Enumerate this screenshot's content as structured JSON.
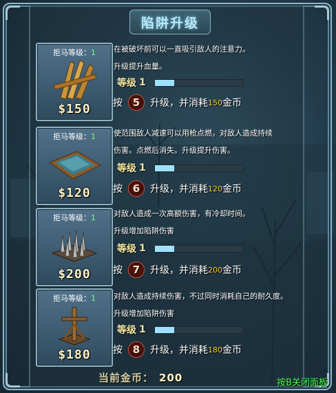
{
  "panel": {
    "title": "陷阱升级",
    "current_gold_label": "当前金币：",
    "current_gold_value": "200",
    "close_hint": "按B关闭面板"
  },
  "traps": [
    {
      "card_label": "拒马等级：",
      "card_level": "1",
      "price": "$150",
      "icon": "spiked-stakes-icon",
      "desc_line1": "在被破坏前可以一直吸引敌人的注意力。",
      "desc_line2": "升级提升血量。",
      "level_label": "等级",
      "level_value": "1",
      "level_progress_percent": 22,
      "press_label": "按",
      "key": "5",
      "upgrade_text": "升级，并消耗",
      "cost": "150",
      "currency": "金币"
    },
    {
      "card_label": "拒马等级：",
      "card_level": "1",
      "price": "$120",
      "icon": "oil-slick-trap-icon",
      "desc_line1": "使范围敌人减速可以用枪点燃，对敌人造成持续",
      "desc_line2": "伤害。点燃后消失。升级提升伤害。",
      "level_label": "等级",
      "level_value": "1",
      "level_progress_percent": 22,
      "press_label": "按",
      "key": "6",
      "upgrade_text": "升级，并消耗",
      "cost": "120",
      "currency": "金币"
    },
    {
      "card_label": "拒马等级：",
      "card_level": "1",
      "price": "$200",
      "icon": "spike-trap-icon",
      "desc_line1": "对敌人造成一次高额伤害，有冷却时间。",
      "desc_line2": "升级增加陷阱伤害",
      "level_label": "等级",
      "level_value": "1",
      "level_progress_percent": 22,
      "press_label": "按",
      "key": "7",
      "upgrade_text": "升级，并消耗",
      "cost": "200",
      "currency": "金币"
    },
    {
      "card_label": "拒马等级：",
      "card_level": "1",
      "price": "$180",
      "icon": "wooden-cross-trap-icon",
      "desc_line1": "对敌人造成持续伤害，不过同时消耗自己的耐久度。",
      "desc_line2": "升级增加陷阱伤害",
      "level_label": "等级",
      "level_value": "1",
      "level_progress_percent": 22,
      "press_label": "按",
      "key": "8",
      "upgrade_text": "升级，并消耗",
      "cost": "180",
      "currency": "金币"
    }
  ],
  "colors": {
    "level_text": "#f5e7a4",
    "cost_text": "#ffcc33",
    "card_level_num": "#7dff7d",
    "close_hint": "#4cff4c",
    "progress_fill": "#9fe2ff"
  }
}
